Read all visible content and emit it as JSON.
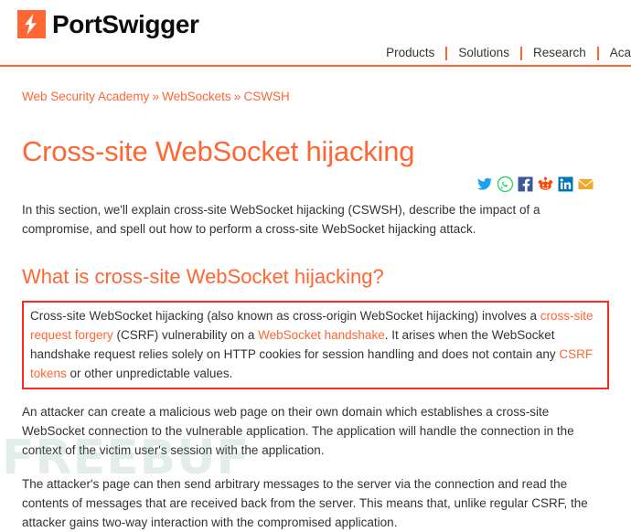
{
  "header": {
    "logo_text": "PortSwigger",
    "logo_icon": "lightning-bolt-icon",
    "nav": [
      {
        "label": "Products"
      },
      {
        "label": "Solutions"
      },
      {
        "label": "Research"
      },
      {
        "label": "Aca"
      }
    ],
    "accent_color": "#ff6633"
  },
  "breadcrumb": {
    "separator": "»",
    "items": [
      {
        "label": "Web Security Academy"
      },
      {
        "label": "WebSockets"
      },
      {
        "label": "CSWSH"
      }
    ]
  },
  "page": {
    "title": "Cross-site WebSocket hijacking",
    "section_title": "What is cross-site WebSocket hijacking?"
  },
  "share": {
    "icons": [
      {
        "name": "twitter-icon",
        "color": "#1da1f2"
      },
      {
        "name": "whatsapp-icon",
        "color": "#25d366"
      },
      {
        "name": "facebook-icon",
        "color": "#3b5998"
      },
      {
        "name": "reddit-icon",
        "color": "#ff4500"
      },
      {
        "name": "linkedin-icon",
        "color": "#0077b5"
      },
      {
        "name": "email-icon",
        "color": "#f6a623"
      }
    ]
  },
  "content": {
    "intro": "In this section, we'll explain cross-site WebSocket hijacking (CSWSH), describe the impact of a compromise, and spell out how to perform a cross-site WebSocket hijacking attack.",
    "highlight": {
      "t1": "Cross-site WebSocket hijacking (also known as cross-origin WebSocket hijacking) involves a ",
      "link1": "cross-site request forgery",
      "t2": " (CSRF) vulnerability on a ",
      "link2": "WebSocket handshake",
      "t3": ". It arises when the WebSocket handshake request relies solely on HTTP cookies for session handling and does not contain any ",
      "link3": "CSRF tokens",
      "t4": " or other unpredictable values."
    },
    "para_2": "An attacker can create a malicious web page on their own domain which establishes a cross-site WebSocket connection to the vulnerable application. The application will handle the connection in the context of the victim user's session with the application.",
    "para_3": "The attacker's page can then send arbitrary messages to the server via the connection and read the contents of messages that are received back from the server. This means that, unlike regular CSRF, the attacker gains two-way interaction with the compromised application."
  },
  "watermark": {
    "text": "FREEBUF"
  }
}
